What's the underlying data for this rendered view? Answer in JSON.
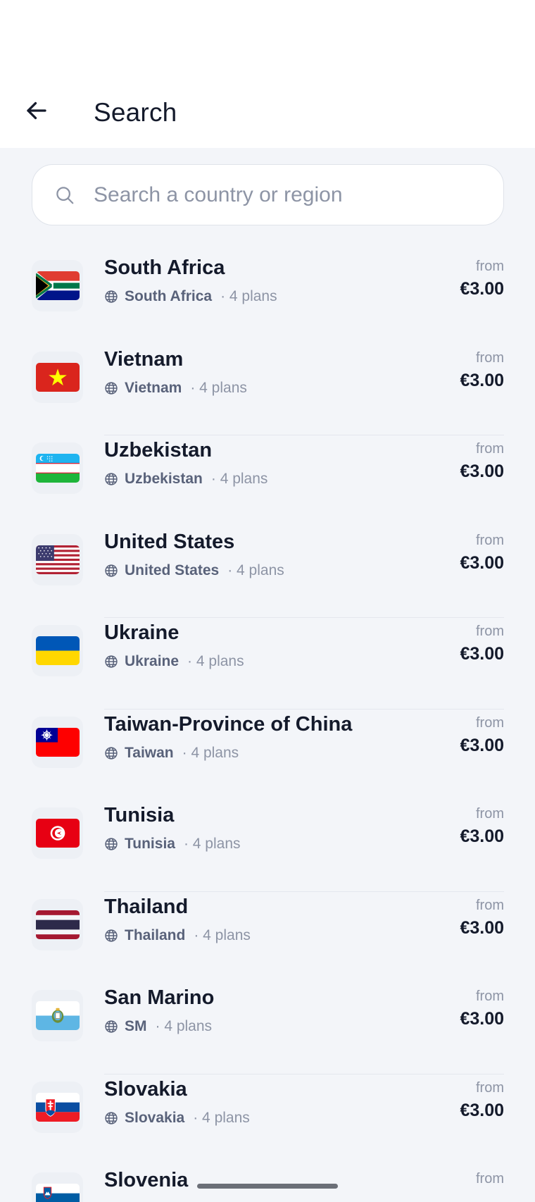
{
  "header": {
    "title": "Search"
  },
  "search": {
    "placeholder": "Search a country or region",
    "value": ""
  },
  "countries": [
    {
      "name": "South Africa",
      "region": "South Africa",
      "plans": "· 4 plans",
      "from": "from",
      "price": "€3.00",
      "flag": "za"
    },
    {
      "name": "Vietnam",
      "region": "Vietnam",
      "plans": "· 4 plans",
      "from": "from",
      "price": "€3.00",
      "flag": "vn"
    },
    {
      "name": "Uzbekistan",
      "region": "Uzbekistan",
      "plans": "· 4 plans",
      "from": "from",
      "price": "€3.00",
      "flag": "uz"
    },
    {
      "name": "United States",
      "region": "United States",
      "plans": "· 4 plans",
      "from": "from",
      "price": "€3.00",
      "flag": "us"
    },
    {
      "name": "Ukraine",
      "region": "Ukraine",
      "plans": "· 4 plans",
      "from": "from",
      "price": "€3.00",
      "flag": "ua"
    },
    {
      "name": "Taiwan-Province of China",
      "region": "Taiwan",
      "plans": "· 4 plans",
      "from": "from",
      "price": "€3.00",
      "flag": "tw"
    },
    {
      "name": "Tunisia",
      "region": "Tunisia",
      "plans": "· 4 plans",
      "from": "from",
      "price": "€3.00",
      "flag": "tn"
    },
    {
      "name": "Thailand",
      "region": "Thailand",
      "plans": "· 4 plans",
      "from": "from",
      "price": "€3.00",
      "flag": "th"
    },
    {
      "name": "San Marino",
      "region": "SM",
      "plans": "· 4 plans",
      "from": "from",
      "price": "€3.00",
      "flag": "sm"
    },
    {
      "name": "Slovakia",
      "region": "Slovakia",
      "plans": "· 4 plans",
      "from": "from",
      "price": "€3.00",
      "flag": "sk"
    },
    {
      "name": "Slovenia",
      "region": "",
      "plans": "",
      "from": "from",
      "price": "",
      "flag": "si"
    }
  ],
  "icons": {
    "back": "arrow-left-icon",
    "search": "search-icon",
    "globe": "globe-icon"
  },
  "colors": {
    "text": "#141a2b",
    "muted": "#8d94a5",
    "region": "#59627a",
    "background": "#f3f5f9"
  }
}
